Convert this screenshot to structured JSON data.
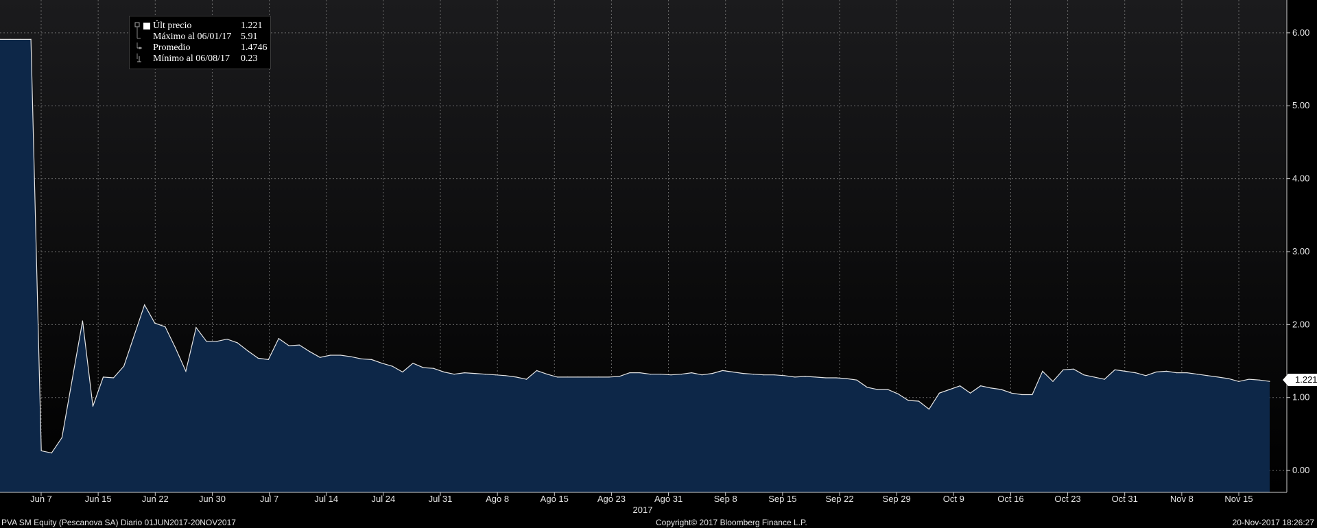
{
  "chart_data": {
    "type": "area",
    "title": "",
    "xlabel": "2017",
    "ylabel": "",
    "ylim": [
      -0.3,
      6.45
    ],
    "yticks": [
      0,
      1,
      2,
      3,
      4,
      5,
      6
    ],
    "ytick_labels": [
      "0.00",
      "1.00",
      "2.00",
      "3.00",
      "4.00",
      "5.00",
      "6.00"
    ],
    "xtick_labels": [
      "Jun 7",
      "Jun 15",
      "Jun 22",
      "Jun 30",
      "Jul 7",
      "Jul 14",
      "Jul 24",
      "Jul 31",
      "Ago 8",
      "Ago 15",
      "Ago 23",
      "Ago 31",
      "Sep 8",
      "Sep 15",
      "Sep 22",
      "Sep 29",
      "Oct 9",
      "Oct 16",
      "Oct 23",
      "Oct 31",
      "Nov 8",
      "Nov 15"
    ],
    "grid": true,
    "legend_position": "top-left",
    "colors": {
      "background_top": "#1b1b1d",
      "background_bottom": "#000000",
      "area_fill": "#0d2748",
      "line": "#e6e6e6",
      "grid": "#6b6b6b"
    },
    "series": [
      {
        "name": "Últ precio",
        "values": [
          5.91,
          5.91,
          5.91,
          5.91,
          0.27,
          0.24,
          0.45,
          1.25,
          2.05,
          0.88,
          1.28,
          1.27,
          1.43,
          1.85,
          2.27,
          2.02,
          1.97,
          1.68,
          1.36,
          1.96,
          1.77,
          1.77,
          1.8,
          1.75,
          1.64,
          1.54,
          1.52,
          1.81,
          1.71,
          1.72,
          1.63,
          1.55,
          1.58,
          1.58,
          1.56,
          1.53,
          1.52,
          1.47,
          1.43,
          1.35,
          1.47,
          1.41,
          1.4,
          1.35,
          1.32,
          1.34,
          1.33,
          1.32,
          1.31,
          1.3,
          1.28,
          1.25,
          1.37,
          1.32,
          1.28,
          1.28,
          1.28,
          1.28,
          1.28,
          1.28,
          1.29,
          1.34,
          1.34,
          1.32,
          1.32,
          1.31,
          1.32,
          1.34,
          1.31,
          1.33,
          1.37,
          1.35,
          1.33,
          1.32,
          1.31,
          1.31,
          1.3,
          1.28,
          1.29,
          1.28,
          1.27,
          1.27,
          1.26,
          1.24,
          1.14,
          1.11,
          1.11,
          1.05,
          0.96,
          0.95,
          0.84,
          1.06,
          1.11,
          1.16,
          1.06,
          1.16,
          1.13,
          1.11,
          1.06,
          1.04,
          1.04,
          1.36,
          1.22,
          1.38,
          1.39,
          1.31,
          1.28,
          1.25,
          1.38,
          1.36,
          1.34,
          1.3,
          1.35,
          1.36,
          1.34,
          1.34,
          1.32,
          1.3,
          1.28,
          1.26,
          1.22,
          1.25,
          1.24,
          1.221
        ]
      }
    ],
    "legend": {
      "rows": [
        {
          "label": "Últ precio",
          "value": "1.221"
        },
        {
          "label": "Máximo al 06/01/17",
          "value": "5.91"
        },
        {
          "label": "Promedio",
          "value": "1.4746"
        },
        {
          "label": "Mínimo al 06/08/17",
          "value": "0.23"
        }
      ]
    },
    "last_value_label": "1.221"
  },
  "footer": {
    "left": "PVA SM Equity (Pescanova SA)  Diario 01JUN2017-20NOV2017",
    "center": "Copyright© 2017 Bloomberg Finance L.P.",
    "right": "20-Nov-2017 18:26:27"
  }
}
